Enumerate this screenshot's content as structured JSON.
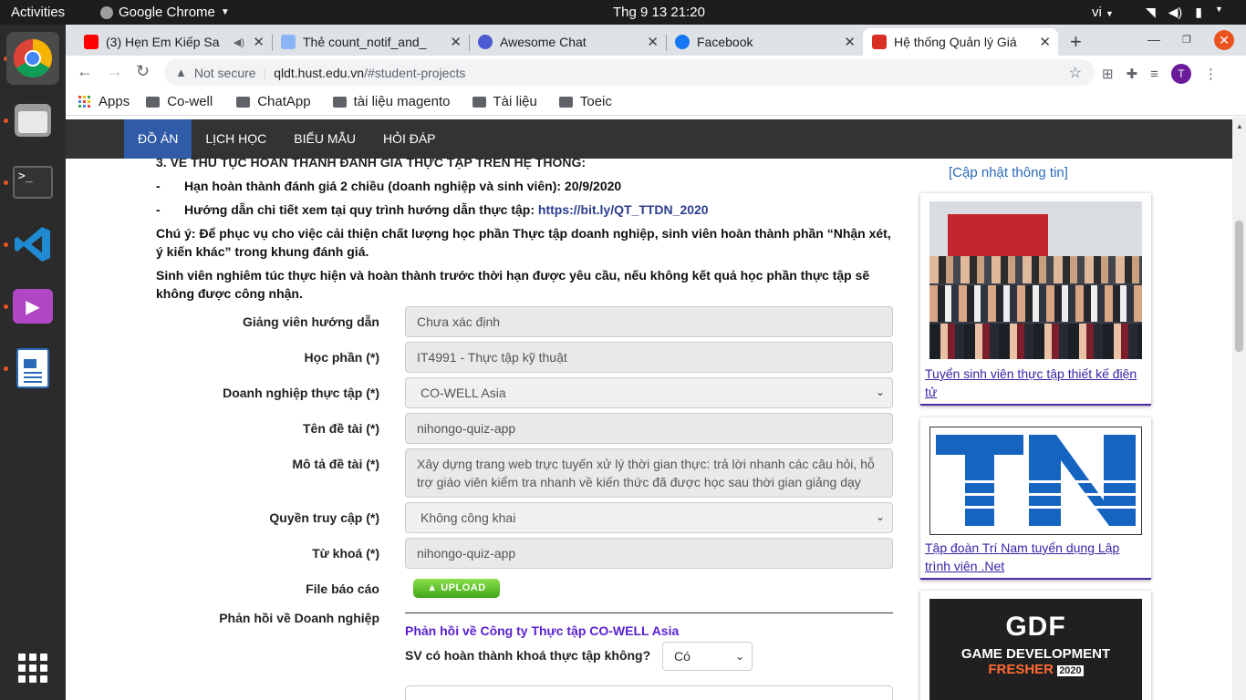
{
  "os": {
    "activities": "Activities",
    "app_name": "Google Chrome",
    "clock": "Thg 9 13  21:20",
    "lang": "vi"
  },
  "browser": {
    "tabs": [
      {
        "title": "(3) Hẹn Em Kiếp Sa",
        "favicon_color": "#ff0000"
      },
      {
        "title": "Thẻ count_notif_and_",
        "favicon_color": "#8ab4f8"
      },
      {
        "title": "Awesome Chat",
        "favicon_color": "#4b5bd1"
      },
      {
        "title": "Facebook",
        "favicon_color": "#1877f2"
      },
      {
        "title": "Hệ thống Quản lý Giá",
        "favicon_color": "#d93025"
      }
    ],
    "not_secure": "Not secure",
    "url_host": "qldt.hust.edu.vn",
    "url_path": "/#student-projects",
    "profile_initial": "T",
    "bookmarks": [
      "Apps",
      "Co-well",
      "ChatApp",
      "tài liệu magento",
      "Tài liệu",
      "Toeic"
    ]
  },
  "site_nav": [
    "ĐỒ ÁN",
    "LỊCH HỌC",
    "BIỂU MẪU",
    "HỎI ĐÁP"
  ],
  "content": {
    "cut_heading": "3. VỀ THỦ TỤC HOÀN THÀNH ĐÁNH GIÁ THỰC TẬP TRÊN HỆ THỐNG:",
    "bullet1_dash": "-",
    "bullet1": "Hạn hoàn thành đánh giá 2 chiều (doanh nghiệp và sinh viên): 20/9/2020",
    "bullet2_dash": "-",
    "bullet2": "Hướng dẫn chi tiết xem tại quy trình hướng dẫn thực tập: ",
    "bullet2_link": "https://bit.ly/QT_TTDN_2020",
    "note1": "Chú ý: Để phục vụ cho việc cải thiện chất lượng học phần Thực tập doanh nghiệp, sinh viên hoàn thành phần “Nhận xét, ý kiến khác” trong khung đánh giá.",
    "note2": "Sinh viên nghiêm túc thực hiện và hoàn thành trước thời hạn được yêu cầu, nếu không kết quả học phần thực tập sẽ không được công nhận."
  },
  "form": {
    "supervisor": {
      "label": "Giảng viên hướng dẫn",
      "value": "Chưa xác định"
    },
    "course": {
      "label": "Học phần (*)",
      "value": "IT4991 - Thực tập kỹ thuật"
    },
    "company": {
      "label": "Doanh nghiệp thực tập (*)",
      "value": "CO-WELL Asia"
    },
    "topic": {
      "label": "Tên đề tài (*)",
      "value": "nihongo-quiz-app"
    },
    "description": {
      "label": "Mô tả đề tài (*)",
      "value": "Xây dựng trang web trực tuyến xử lý thời gian thực: trả lời nhanh các câu hỏi, hỗ trợ giáo viên kiểm tra nhanh về kiến thức đã được học sau thời gian giảng dạy"
    },
    "access": {
      "label": "Quyền truy cập (*)",
      "value": "Không công khai"
    },
    "keywords": {
      "label": "Từ khoá (*)",
      "value": "nihongo-quiz-app"
    },
    "report": {
      "label": "File báo cáo",
      "button": "UPLOAD"
    },
    "feedback": {
      "label": "Phản hồi về Doanh nghiệp",
      "title": "Phản hồi về Công ty Thực tập CO-WELL Asia",
      "question": "SV có hoàn thành khoá thực tập không?",
      "answer": "Có"
    }
  },
  "sidebar": {
    "update_link": "[Cập nhật thông tin]",
    "card1_link": "Tuyển sinh viên thực tập thiết kế điện tử",
    "card2_logo": "TN",
    "card2_link": "Tập đoàn Trí Nam tuyển dụng Lập trình viên .Net",
    "card3_logo": "GDF",
    "card3_line1": "GAME DEVELOPMENT",
    "card3_line2": "FRESHER",
    "card3_year": "2020"
  }
}
